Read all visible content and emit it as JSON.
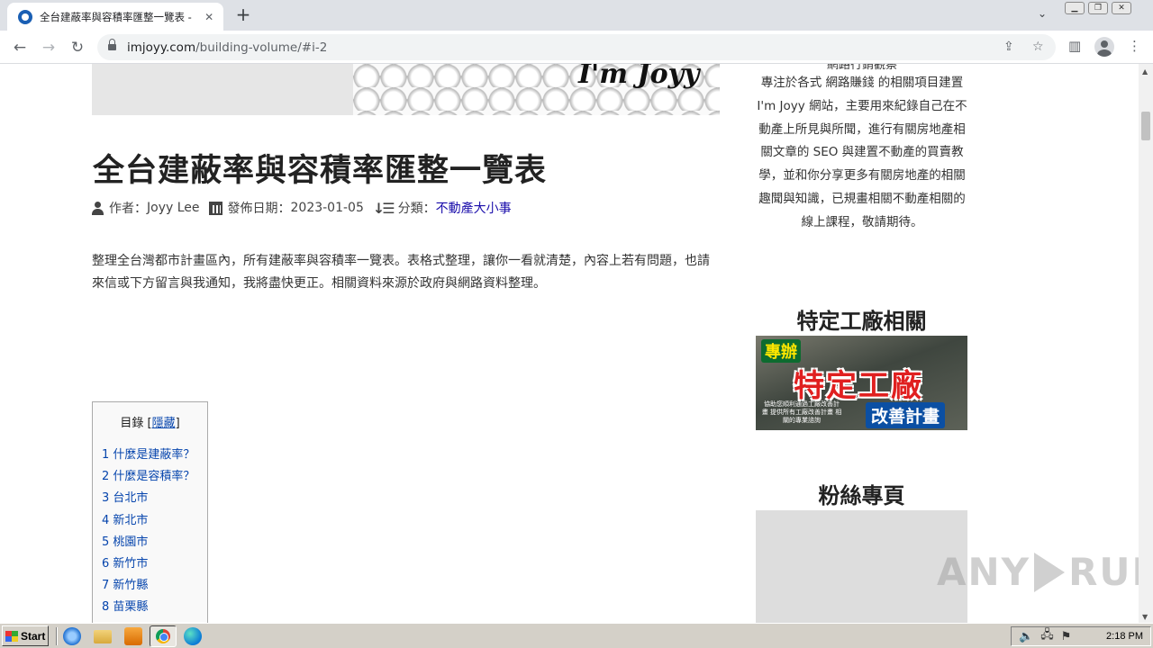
{
  "browser": {
    "tab_title": "全台建蔽率與容積率匯整一覽表 - I'm Joyy",
    "tab_close": "✕",
    "new_tab": "+",
    "url_host": "imjoyy.com",
    "url_path": "/building-volume/#i-2"
  },
  "hero": {
    "brand": "I'm Joyy"
  },
  "article": {
    "title": "全台建蔽率與容積率匯整一覽表",
    "author_label": "作者：",
    "author": "Joyy Lee",
    "date_label": "發佈日期：",
    "date": "2023-01-05",
    "category_label": "分類：",
    "category": "不動產大小事",
    "intro": "整理全台灣都市計畫區內，所有建蔽率與容積率一覽表。表格式整理，讓你一看就清楚，內容上若有問題，也請來信或下方留言與我通知，我將盡快更正。相關資料來源於政府與網路資料整理。"
  },
  "toc": {
    "title": "目錄",
    "bracket_open": "[",
    "toggle": "隱藏",
    "bracket_close": "]",
    "items": [
      "1 什麼是建蔽率？",
      "2 什麼是容積率？",
      "3 台北市",
      "4 新北市",
      "5 桃園市",
      "6 新竹市",
      "7 新竹縣",
      "8 苗栗縣"
    ]
  },
  "sidebar": {
    "about_top": "網路行銷觀察",
    "about": "專注於各式 網路賺錢 的相關項目建置 I'm Joyy 網站，主要用來紀錄自己在不動產上所見與所聞，進行有關房地產相關文章的 SEO 與建置不動產的買賣教學，並和你分享更多有關房地產的相關趣聞與知識，已規畫相關不動產相關的線上課程，敬請期待。",
    "factory_heading": "特定工廠相關",
    "ad_tag": "專辦",
    "ad_main": "特定工廠",
    "ad_small": "協助您順利通過工廠改善計畫 提供所有工廠改善計畫 相關的專業諮詢",
    "ad_sub": "改善計畫",
    "fans_heading": "粉絲專頁"
  },
  "watermark": {
    "left": "ANY",
    "right": "RUN"
  },
  "taskbar": {
    "start": "Start",
    "time": "2:18 PM"
  }
}
